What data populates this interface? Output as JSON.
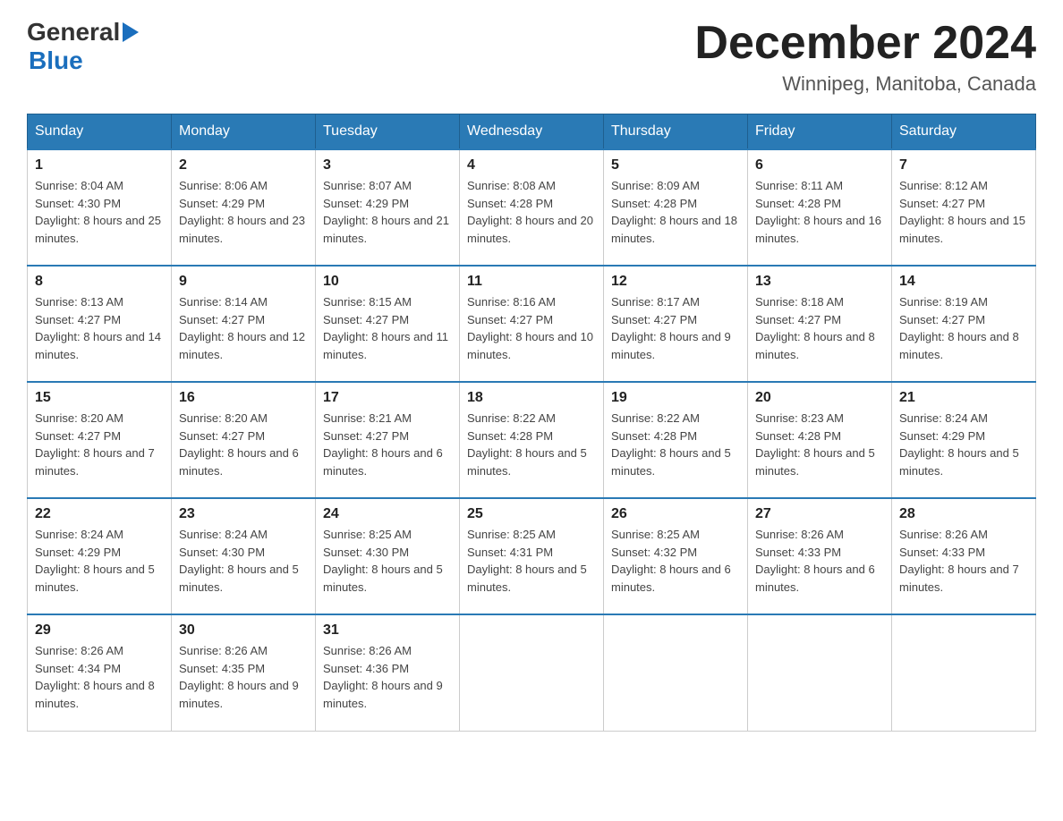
{
  "header": {
    "logo_general": "General",
    "logo_blue": "Blue",
    "title": "December 2024",
    "subtitle": "Winnipeg, Manitoba, Canada"
  },
  "weekdays": [
    "Sunday",
    "Monday",
    "Tuesday",
    "Wednesday",
    "Thursday",
    "Friday",
    "Saturday"
  ],
  "weeks": [
    [
      {
        "day": "1",
        "sunrise": "8:04 AM",
        "sunset": "4:30 PM",
        "daylight": "8 hours and 25 minutes."
      },
      {
        "day": "2",
        "sunrise": "8:06 AM",
        "sunset": "4:29 PM",
        "daylight": "8 hours and 23 minutes."
      },
      {
        "day": "3",
        "sunrise": "8:07 AM",
        "sunset": "4:29 PM",
        "daylight": "8 hours and 21 minutes."
      },
      {
        "day": "4",
        "sunrise": "8:08 AM",
        "sunset": "4:28 PM",
        "daylight": "8 hours and 20 minutes."
      },
      {
        "day": "5",
        "sunrise": "8:09 AM",
        "sunset": "4:28 PM",
        "daylight": "8 hours and 18 minutes."
      },
      {
        "day": "6",
        "sunrise": "8:11 AM",
        "sunset": "4:28 PM",
        "daylight": "8 hours and 16 minutes."
      },
      {
        "day": "7",
        "sunrise": "8:12 AM",
        "sunset": "4:27 PM",
        "daylight": "8 hours and 15 minutes."
      }
    ],
    [
      {
        "day": "8",
        "sunrise": "8:13 AM",
        "sunset": "4:27 PM",
        "daylight": "8 hours and 14 minutes."
      },
      {
        "day": "9",
        "sunrise": "8:14 AM",
        "sunset": "4:27 PM",
        "daylight": "8 hours and 12 minutes."
      },
      {
        "day": "10",
        "sunrise": "8:15 AM",
        "sunset": "4:27 PM",
        "daylight": "8 hours and 11 minutes."
      },
      {
        "day": "11",
        "sunrise": "8:16 AM",
        "sunset": "4:27 PM",
        "daylight": "8 hours and 10 minutes."
      },
      {
        "day": "12",
        "sunrise": "8:17 AM",
        "sunset": "4:27 PM",
        "daylight": "8 hours and 9 minutes."
      },
      {
        "day": "13",
        "sunrise": "8:18 AM",
        "sunset": "4:27 PM",
        "daylight": "8 hours and 8 minutes."
      },
      {
        "day": "14",
        "sunrise": "8:19 AM",
        "sunset": "4:27 PM",
        "daylight": "8 hours and 8 minutes."
      }
    ],
    [
      {
        "day": "15",
        "sunrise": "8:20 AM",
        "sunset": "4:27 PM",
        "daylight": "8 hours and 7 minutes."
      },
      {
        "day": "16",
        "sunrise": "8:20 AM",
        "sunset": "4:27 PM",
        "daylight": "8 hours and 6 minutes."
      },
      {
        "day": "17",
        "sunrise": "8:21 AM",
        "sunset": "4:27 PM",
        "daylight": "8 hours and 6 minutes."
      },
      {
        "day": "18",
        "sunrise": "8:22 AM",
        "sunset": "4:28 PM",
        "daylight": "8 hours and 5 minutes."
      },
      {
        "day": "19",
        "sunrise": "8:22 AM",
        "sunset": "4:28 PM",
        "daylight": "8 hours and 5 minutes."
      },
      {
        "day": "20",
        "sunrise": "8:23 AM",
        "sunset": "4:28 PM",
        "daylight": "8 hours and 5 minutes."
      },
      {
        "day": "21",
        "sunrise": "8:24 AM",
        "sunset": "4:29 PM",
        "daylight": "8 hours and 5 minutes."
      }
    ],
    [
      {
        "day": "22",
        "sunrise": "8:24 AM",
        "sunset": "4:29 PM",
        "daylight": "8 hours and 5 minutes."
      },
      {
        "day": "23",
        "sunrise": "8:24 AM",
        "sunset": "4:30 PM",
        "daylight": "8 hours and 5 minutes."
      },
      {
        "day": "24",
        "sunrise": "8:25 AM",
        "sunset": "4:30 PM",
        "daylight": "8 hours and 5 minutes."
      },
      {
        "day": "25",
        "sunrise": "8:25 AM",
        "sunset": "4:31 PM",
        "daylight": "8 hours and 5 minutes."
      },
      {
        "day": "26",
        "sunrise": "8:25 AM",
        "sunset": "4:32 PM",
        "daylight": "8 hours and 6 minutes."
      },
      {
        "day": "27",
        "sunrise": "8:26 AM",
        "sunset": "4:33 PM",
        "daylight": "8 hours and 6 minutes."
      },
      {
        "day": "28",
        "sunrise": "8:26 AM",
        "sunset": "4:33 PM",
        "daylight": "8 hours and 7 minutes."
      }
    ],
    [
      {
        "day": "29",
        "sunrise": "8:26 AM",
        "sunset": "4:34 PM",
        "daylight": "8 hours and 8 minutes."
      },
      {
        "day": "30",
        "sunrise": "8:26 AM",
        "sunset": "4:35 PM",
        "daylight": "8 hours and 9 minutes."
      },
      {
        "day": "31",
        "sunrise": "8:26 AM",
        "sunset": "4:36 PM",
        "daylight": "8 hours and 9 minutes."
      },
      null,
      null,
      null,
      null
    ]
  ],
  "labels": {
    "sunrise": "Sunrise:",
    "sunset": "Sunset:",
    "daylight": "Daylight:"
  }
}
